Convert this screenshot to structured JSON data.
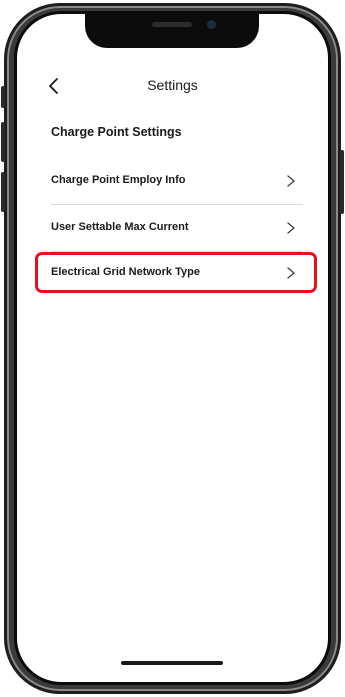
{
  "header": {
    "title": "Settings",
    "back_icon": "chevron-left-icon"
  },
  "section": {
    "title": "Charge Point Settings"
  },
  "rows": [
    {
      "label": "Charge Point Employ Info",
      "icon": "chevron-right-icon"
    },
    {
      "label": "User Settable Max Current",
      "icon": "chevron-right-icon"
    },
    {
      "label": "Electrical Grid Network Type",
      "icon": "chevron-right-icon"
    }
  ],
  "highlighted_row": "Electrical Grid Network Type",
  "colors": {
    "highlight": "#e3141c",
    "text": "#1a1a1a",
    "divider": "#d9d9d9",
    "phone_frame": "#3a3a3c"
  }
}
